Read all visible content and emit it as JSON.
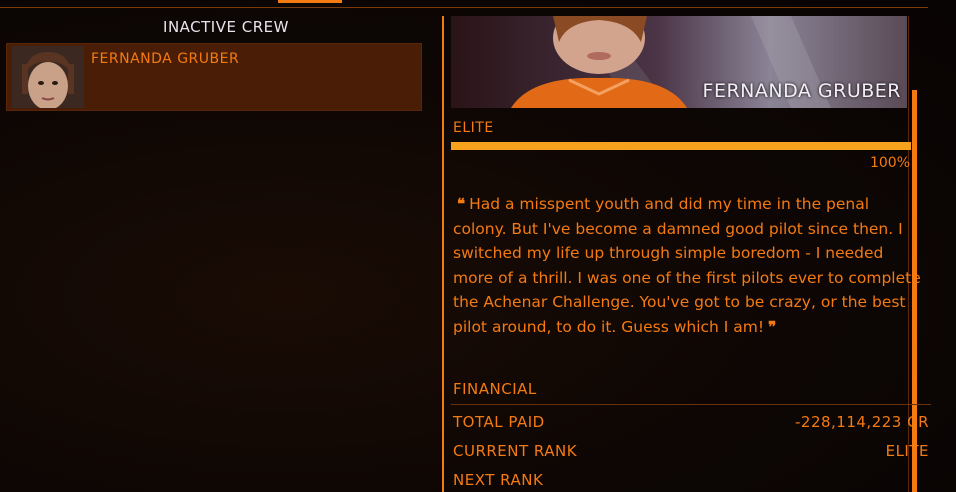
{
  "crew_list": {
    "title": "INACTIVE CREW",
    "items": [
      {
        "name": "FERNANDA GRUBER"
      }
    ]
  },
  "detail": {
    "name": "FERNANDA GRUBER",
    "rank": "ELITE",
    "progress_text": "100%",
    "progress_value": 1.0,
    "quote": "Had a misspent youth and did my time in the penal colony. But I've become a damned good pilot since then. I switched my life up through simple boredom - I needed more of a thrill. I was one of the first pilots ever to complete the Achenar Challenge. You've got to be crazy, or the best pilot around, to do it. Guess which I am!",
    "open_quote_mark": "❝",
    "close_quote_mark": "❞"
  },
  "financial": {
    "title": "FINANCIAL",
    "rows": [
      {
        "label": "TOTAL PAID",
        "value": "-228,114,223 CR"
      },
      {
        "label": "CURRENT RANK",
        "value": "ELITE"
      },
      {
        "label": "NEXT RANK",
        "value": ""
      }
    ]
  },
  "colors": {
    "accent": "#f47a12",
    "progress": "#f7a21c",
    "selected_bg": "#4a1e06",
    "text_light": "#e8e4ec"
  }
}
